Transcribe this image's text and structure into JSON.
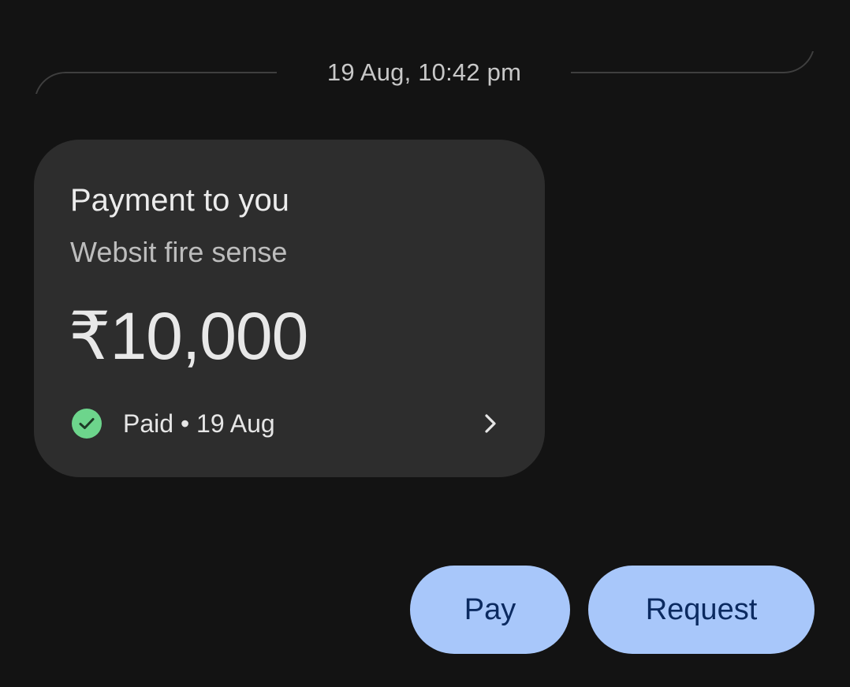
{
  "timestamp": "19 Aug, 10:42 pm",
  "payment_card": {
    "title": "Payment to you",
    "note": "Websit fire sense",
    "amount": "₹10,000",
    "status_text": "Paid • 19 Aug",
    "status_icon": "check-circle-icon",
    "status_color": "#6dd58c",
    "chevron_icon": "chevron-right-icon"
  },
  "actions": {
    "pay_label": "Pay",
    "request_label": "Request",
    "button_color": "#a8c7fa",
    "button_text_color": "#0b2a60"
  }
}
